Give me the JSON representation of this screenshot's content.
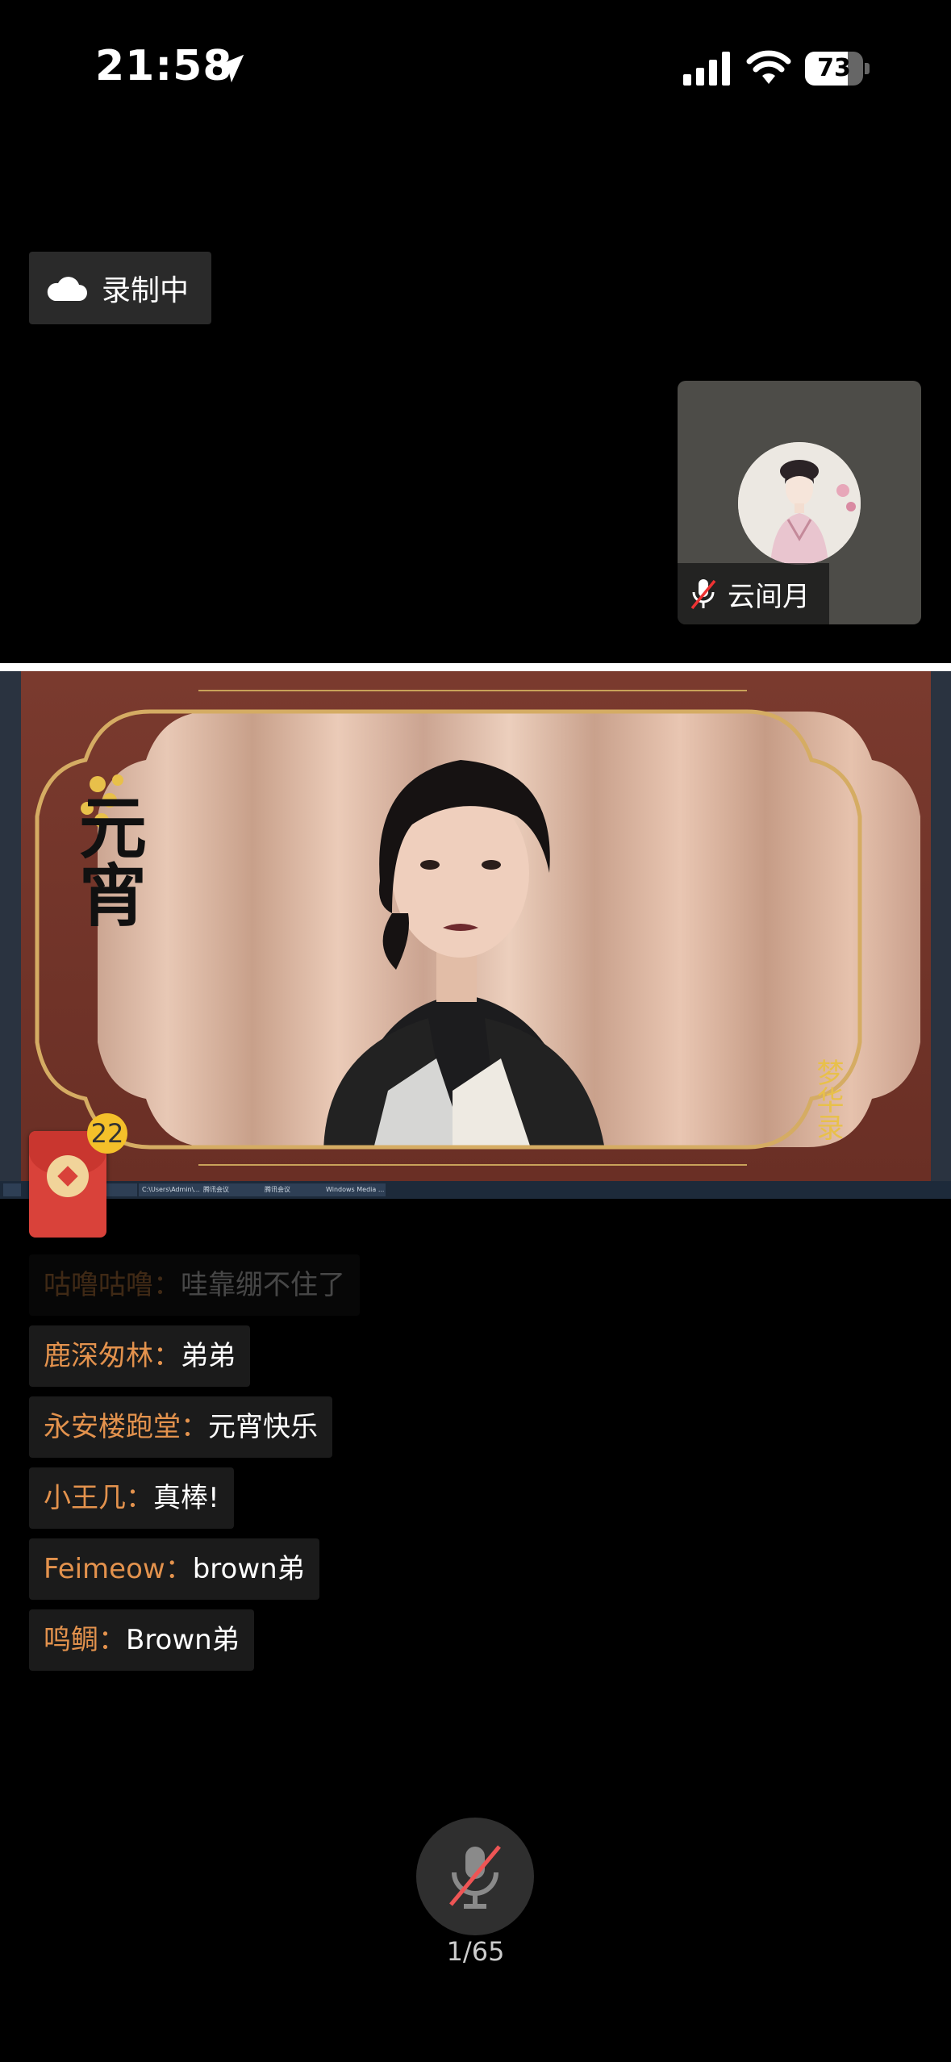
{
  "status_bar": {
    "time": "21:58",
    "battery": "73",
    "battery_level": 0.73
  },
  "recording_badge": {
    "label": "录制中"
  },
  "participant_tile": {
    "name": "云间月"
  },
  "shared_screen": {
    "title_glyphs": "元宵",
    "corner_glyphs": "梦华录",
    "taskbar_items": [
      "",
      "C:\\Users\\Admin\\...",
      "腾讯会议",
      "腾讯会议",
      "Windows Media ..."
    ]
  },
  "red_packet": {
    "count": "22"
  },
  "chat": {
    "messages": [
      {
        "user": "咕噜咕噜：",
        "text": "哇靠绷不住了"
      },
      {
        "user": "鹿深匆林：",
        "text": "弟弟"
      },
      {
        "user": "永安楼跑堂：",
        "text": "元宵快乐"
      },
      {
        "user": "小王几：",
        "text": "真棒!"
      },
      {
        "user": "Feimeow：",
        "text": "brown弟"
      },
      {
        "user": "鸣鲷：",
        "text": "Brown弟"
      }
    ]
  },
  "footer": {
    "page_count": "1/65"
  }
}
